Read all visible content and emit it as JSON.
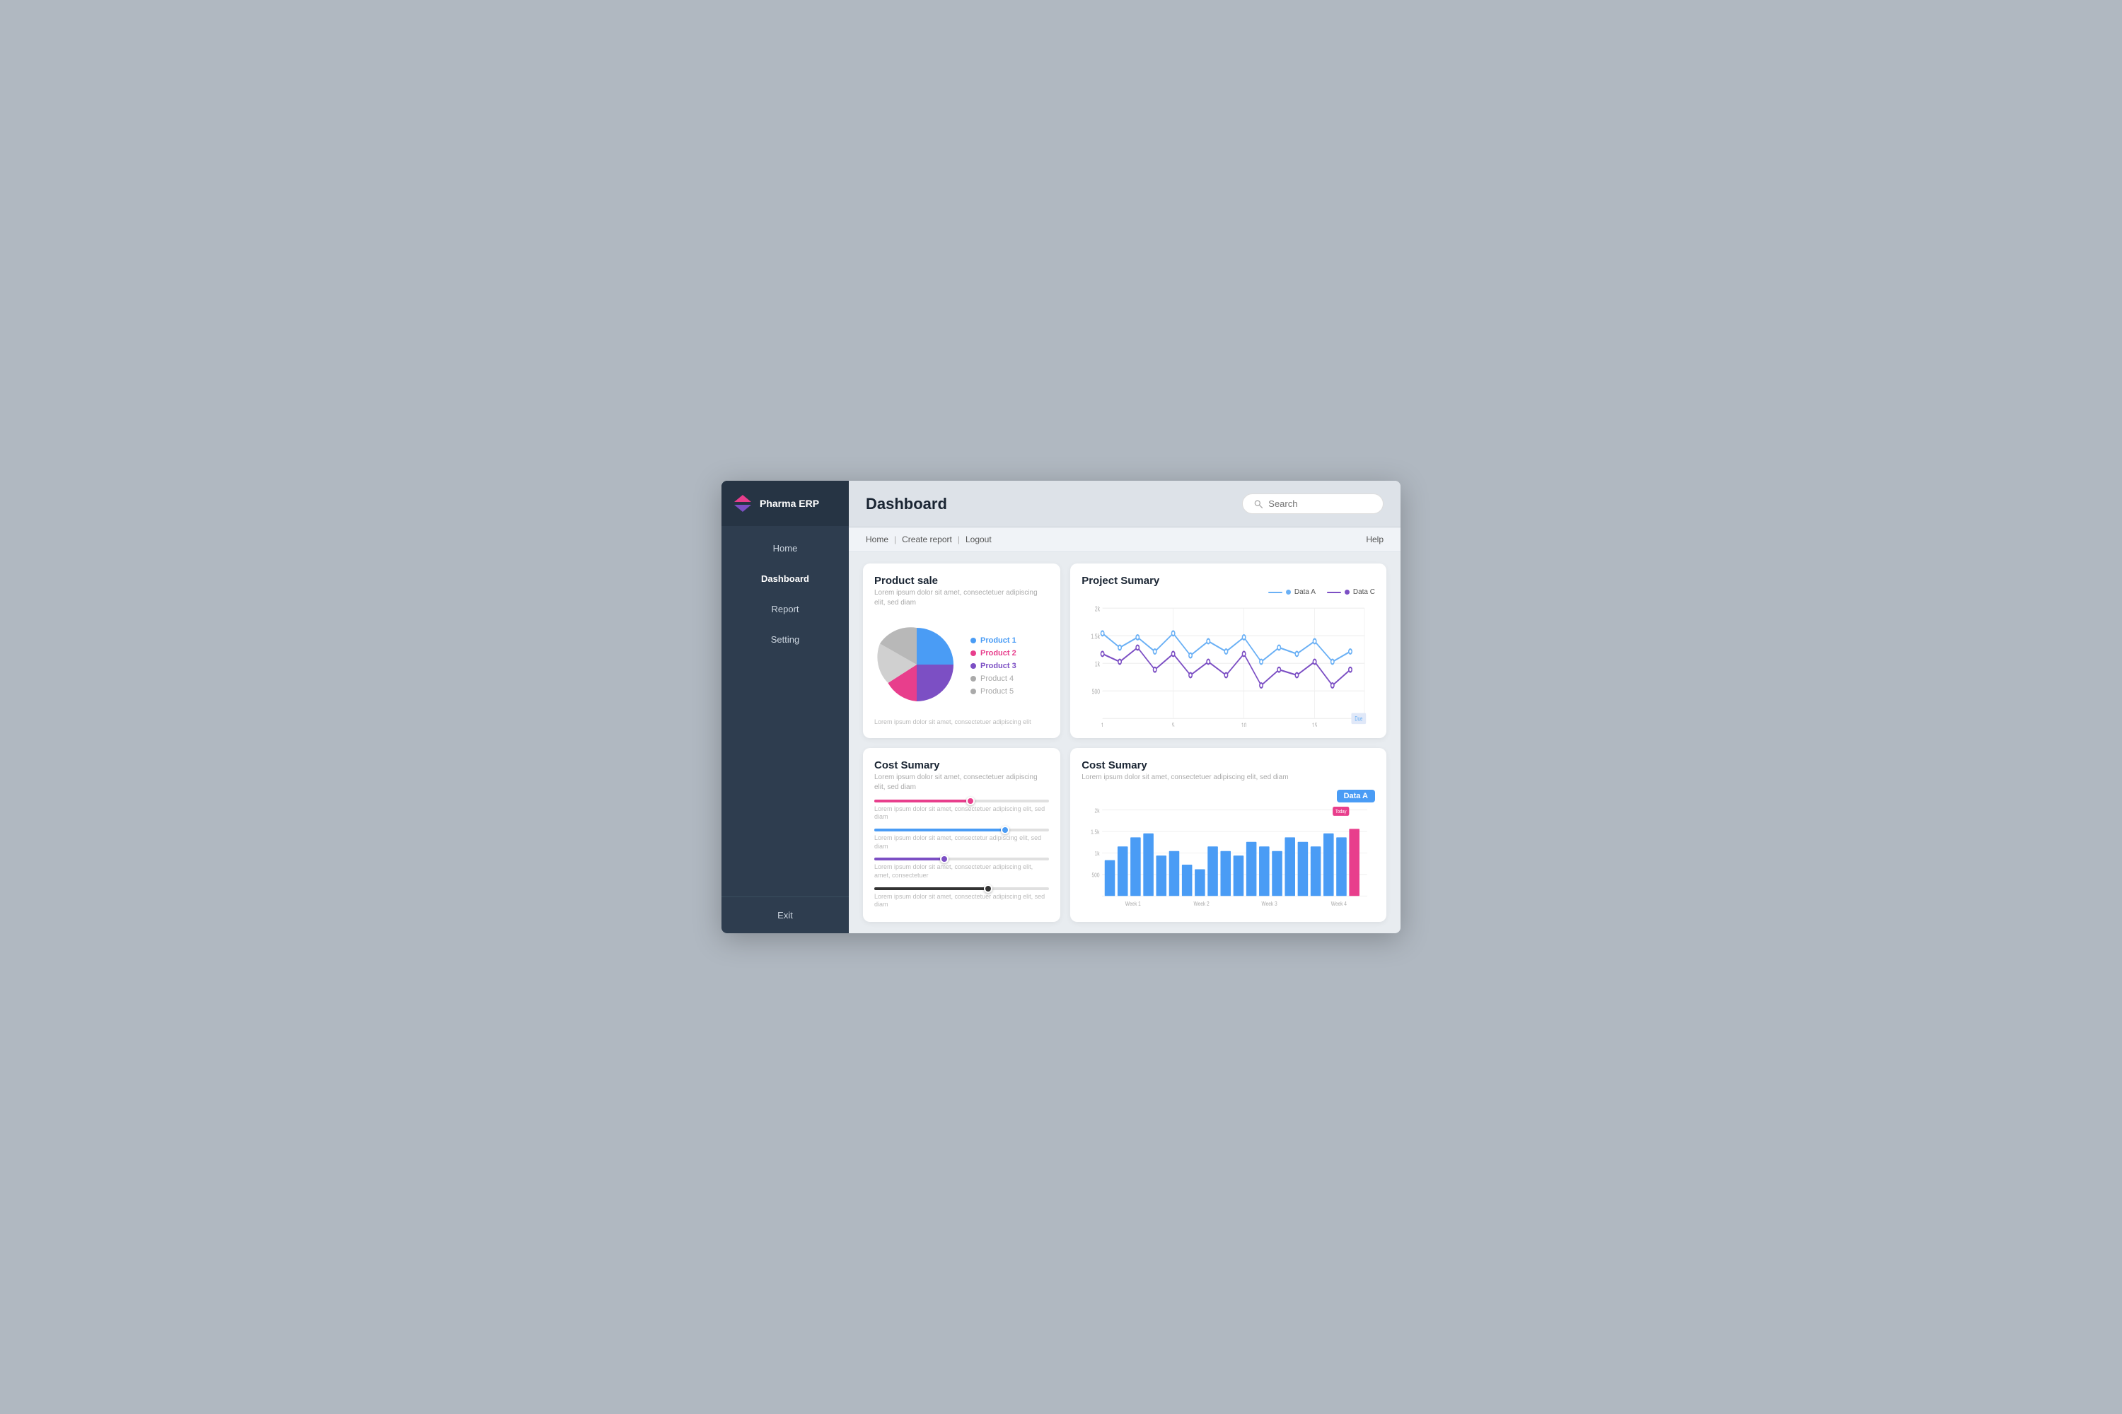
{
  "app": {
    "logo_text": "Pharma ERP",
    "logo_icon": "▲▼"
  },
  "sidebar": {
    "items": [
      {
        "label": "Home",
        "active": false
      },
      {
        "label": "Dashboard",
        "active": true
      },
      {
        "label": "Report",
        "active": false
      },
      {
        "label": "Setting",
        "active": false
      }
    ],
    "exit_label": "Exit"
  },
  "topbar": {
    "title": "Dashboard",
    "search_placeholder": "Search"
  },
  "breadcrumb": {
    "home": "Home",
    "sep1": "|",
    "create_report": "Create report",
    "sep2": "|",
    "logout": "Logout",
    "help": "Help"
  },
  "product_sale": {
    "title": "Product sale",
    "subtitle": "Lorem ipsum dolor sit amet, consectetuer adipiscing elit, sed diam",
    "note": "Lorem ipsum dolor sit amet, consectetuer adipiscing elit",
    "legend": [
      {
        "label": "Product 1",
        "color": "#4a9cf5",
        "bold": true
      },
      {
        "label": "Product 2",
        "color": "#e83e8c",
        "bold": true
      },
      {
        "label": "Product 3",
        "color": "#7c4fc4",
        "bold": true
      },
      {
        "label": "Product 4",
        "color": "#aaa",
        "bold": false
      },
      {
        "label": "Product 5",
        "color": "#aaa",
        "bold": false
      }
    ],
    "slices": [
      {
        "label": "blue",
        "color": "#4a9cf5",
        "percent": 30,
        "start": 0
      },
      {
        "label": "purple",
        "color": "#7c4fc4",
        "percent": 25,
        "start": 30
      },
      {
        "label": "red",
        "color": "#e83e8c",
        "percent": 15,
        "start": 55
      },
      {
        "label": "lightgray",
        "color": "#d0d0d0",
        "percent": 20,
        "start": 70
      },
      {
        "label": "gray",
        "color": "#b0b0b0",
        "percent": 10,
        "start": 90
      }
    ]
  },
  "project_summary": {
    "title": "Project Sumary",
    "legend": [
      {
        "label": "Data A",
        "color": "#6ab0f5"
      },
      {
        "label": "Data C",
        "color": "#7c4fc4"
      }
    ],
    "x_labels": [
      "1",
      "5",
      "10",
      "15"
    ],
    "y_labels": [
      "2k",
      "1.5k",
      "1k",
      "500"
    ],
    "due_label": "Due",
    "data_a": [
      1.8,
      1.5,
      1.7,
      1.4,
      1.6,
      1.3,
      1.5,
      1.4,
      1.6,
      1.2,
      1.4,
      1.3,
      1.5,
      1.2,
      1.3
    ],
    "data_c": [
      1.3,
      1.2,
      1.4,
      1.1,
      1.3,
      1.0,
      1.2,
      1.0,
      1.3,
      0.9,
      1.1,
      1.0,
      1.2,
      0.9,
      1.0
    ]
  },
  "cost_summary_left": {
    "title": "Cost Sumary",
    "subtitle": "Lorem ipsum dolor sit amet, consectetuer adipiscing elit, sed diam",
    "sliders": [
      {
        "color_fill": "#e83e8c",
        "color_thumb": "#e83e8c",
        "pct": 55,
        "label": "Lorem ipsum dolor sit amet, consectetuer adipiscing elit, sed diam"
      },
      {
        "color_fill": "#4a9cf5",
        "color_thumb": "#4a9cf5",
        "pct": 75,
        "label": "Lorem ipsum dolor sit amet, consectetur adipiscing elit, sed diam"
      },
      {
        "color_fill": "#7c4fc4",
        "color_thumb": "#7c4fc4",
        "pct": 40,
        "label": "Lorem ipsum dolor sit amet, consectetuer adipiscing elit, amet, consectetuer"
      },
      {
        "color_fill": "#222",
        "color_thumb": "#333",
        "pct": 65,
        "label": "Lorem ipsum dolor sit amet, consectetuer adipiscing elit, sed diam"
      }
    ]
  },
  "cost_summary_right": {
    "title": "Cost Sumary",
    "subtitle": "Lorem ipsum dolor sit amet, consectetuer adipiscing elit, sed diam",
    "badge_label": "Data A",
    "today_label": "Today",
    "x_labels": [
      "Week 1",
      "Week 2",
      "Week 3",
      "Week 4"
    ],
    "y_labels": [
      "2k",
      "1.5k",
      "1k",
      "500"
    ],
    "bars": [
      0.8,
      1.1,
      1.3,
      1.4,
      0.9,
      1.0,
      0.7,
      0.6,
      1.1,
      1.0,
      0.9,
      1.2,
      1.1,
      1.0,
      1.3,
      1.2,
      1.1,
      1.4,
      1.3,
      1.5
    ],
    "today_bar_index": 19,
    "bar_color": "#4a9cf5",
    "today_color": "#e83e8c"
  }
}
